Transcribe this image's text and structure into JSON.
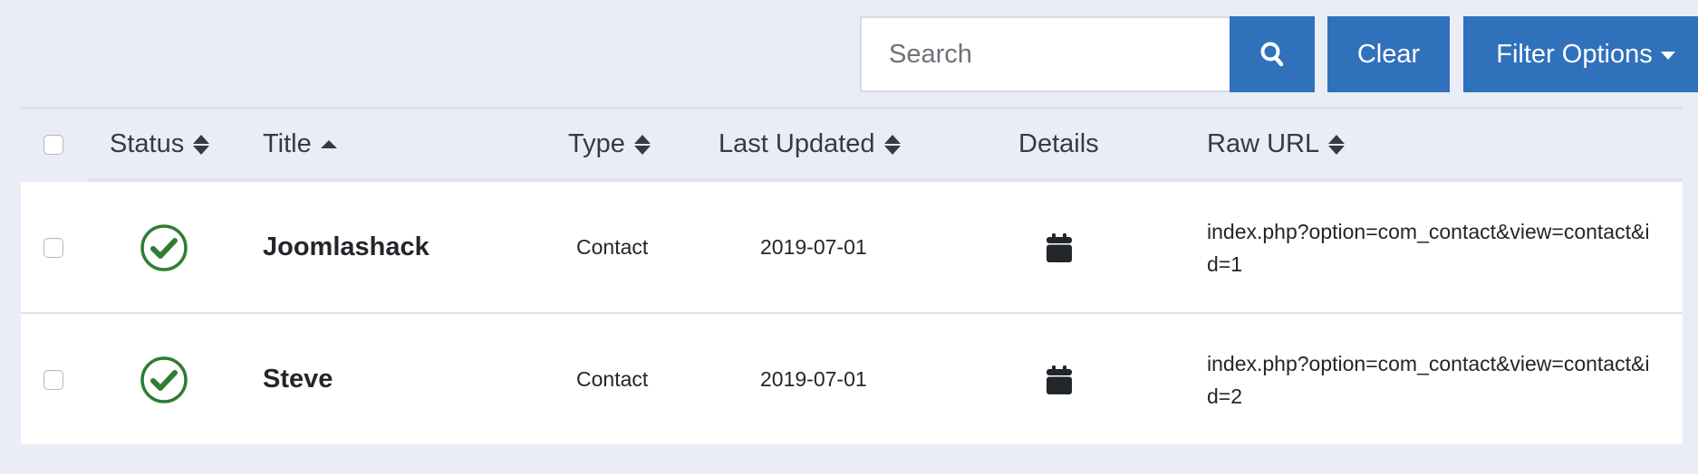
{
  "toolbar": {
    "search_placeholder": "Search",
    "search_value": "",
    "search_button_icon": "search-icon",
    "clear_label": "Clear",
    "filter_label": "Filter Options",
    "filter_icon": "caret-down-icon"
  },
  "colors": {
    "primary": "#3071bb",
    "status_published": "#2f7d32",
    "background": "#eaedf6"
  },
  "table": {
    "columns": [
      {
        "label": "Status",
        "sort": "both"
      },
      {
        "label": "Title",
        "sort": "asc"
      },
      {
        "label": "Type",
        "sort": "both"
      },
      {
        "label": "Last Updated",
        "sort": "both"
      },
      {
        "label": "Details",
        "sort": "none"
      },
      {
        "label": "Raw URL",
        "sort": "both"
      }
    ],
    "rows": [
      {
        "checked": false,
        "status": "published",
        "status_icon": "check-circle-icon",
        "title": "Joomlashack",
        "type": "Contact",
        "last_updated": "2019-07-01",
        "details_icon": "calendar-icon",
        "raw_url": "index.php?option=com_contact&view=contact&id=1"
      },
      {
        "checked": false,
        "status": "published",
        "status_icon": "check-circle-icon",
        "title": "Steve",
        "type": "Contact",
        "last_updated": "2019-07-01",
        "details_icon": "calendar-icon",
        "raw_url": "index.php?option=com_contact&view=contact&id=2"
      }
    ]
  }
}
